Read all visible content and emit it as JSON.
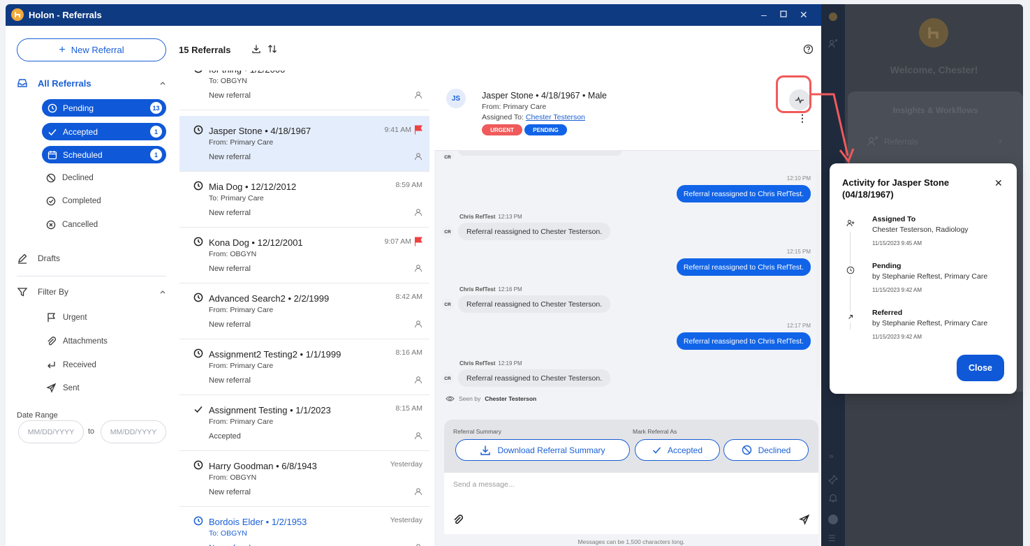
{
  "window": {
    "title": "Holon - Referrals"
  },
  "nav": {
    "new_referral": "New Referral",
    "all_referrals": "All Referrals",
    "pending": {
      "label": "Pending",
      "count": "13"
    },
    "accepted": {
      "label": "Accepted",
      "count": "1"
    },
    "scheduled": {
      "label": "Scheduled",
      "count": "1"
    },
    "declined": "Declined",
    "completed": "Completed",
    "cancelled": "Cancelled",
    "drafts": "Drafts",
    "filter_by": "Filter By",
    "urgent": "Urgent",
    "attachments": "Attachments",
    "received": "Received",
    "sent": "Sent",
    "date_range": "Date Range",
    "date_from_placeholder": "MM/DD/YYYY",
    "date_to": "to",
    "date_to_placeholder": "MM/DD/YYYY"
  },
  "list": {
    "count_label": "15 Referrals",
    "items": [
      {
        "name": "for thing • 1/2/2000",
        "from": "To: OBGYN",
        "status": "New referral",
        "time": ""
      },
      {
        "name": "Jasper Stone • 4/18/1967",
        "from": "From: Primary Care",
        "status": "New referral",
        "time": "9:41 AM"
      },
      {
        "name": "Mia Dog • 12/12/2012",
        "from": "To: Primary Care",
        "status": "New referral",
        "time": "8:59 AM"
      },
      {
        "name": "Kona Dog • 12/12/2001",
        "from": "From: OBGYN",
        "status": "New referral",
        "time": "9:07 AM"
      },
      {
        "name": "Advanced Search2 • 2/2/1999",
        "from": "From: Primary Care",
        "status": "New referral",
        "time": "8:42 AM"
      },
      {
        "name": "Assignment2 Testing2 • 1/1/1999",
        "from": "From: Primary Care",
        "status": "New referral",
        "time": "8:16 AM"
      },
      {
        "name": "Assignment Testing • 1/1/2023",
        "from": "From: Primary Care",
        "status": "Accepted",
        "time": "8:15 AM"
      },
      {
        "name": "Harry Goodman • 6/8/1943",
        "from": "From: OBGYN",
        "status": "New referral",
        "time": "Yesterday"
      },
      {
        "name": "Bordois Elder • 1/2/1953",
        "from": "To: OBGYN",
        "status": "New referral",
        "time": "Yesterday"
      }
    ]
  },
  "detail": {
    "initials": "JS",
    "patient": "Jasper Stone • 4/18/1967 • Male",
    "from": "From: Primary Care",
    "assigned_prefix": "Assigned To:",
    "assigned_to": "Chester Testerson",
    "tags": [
      "URGENT",
      "PENDING"
    ],
    "messages": [
      {
        "side": "right",
        "time": "12:10 PM",
        "text": "Referral reassigned to Chris RefTest."
      },
      {
        "side": "left",
        "author": "Chris RefTest",
        "time": "12:13 PM",
        "initials": "CR",
        "text": "Referral reassigned to Chester Testerson."
      },
      {
        "side": "right",
        "time": "12:15 PM",
        "text": "Referral reassigned to Chris RefTest."
      },
      {
        "side": "left",
        "author": "Chris RefTest",
        "time": "12:16 PM",
        "initials": "CR",
        "text": "Referral reassigned to Chester Testerson."
      },
      {
        "side": "right",
        "time": "12:17 PM",
        "text": "Referral reassigned to Chris RefTest."
      },
      {
        "side": "left",
        "author": "Chris RefTest",
        "time": "12:19 PM",
        "initials": "CR",
        "text": "Referral reassigned to Chester Testerson."
      }
    ],
    "top_initials": "CR",
    "seen_by_prefix": "Seen by",
    "seen_by": "Chester Testerson",
    "summary_label": "Referral Summary",
    "mark_label": "Mark Referral As",
    "download_btn": "Download Referral Summary",
    "accepted_btn": "Accepted",
    "declined_btn": "Declined",
    "message_placeholder": "Send a message...",
    "char_limit": "Messages can be 1,500 characters long."
  },
  "right_panel": {
    "welcome": "Welcome, Chester!",
    "insights": "Insights & Workflows",
    "referrals": "Referrals"
  },
  "activity": {
    "title": "Activity for Jasper Stone (04/18/1967)",
    "entries": [
      {
        "heading": "Assigned To",
        "by": "Chester Testerson, Radiology",
        "date": "11/15/2023 9:45 AM"
      },
      {
        "heading": "Pending",
        "by": "by Stephanie Reftest, Primary Care",
        "date": "11/15/2023 9:42 AM"
      },
      {
        "heading": "Referred",
        "by": "by Stephanie Reftest, Primary Care",
        "date": "11/15/2023 9:42 AM"
      }
    ],
    "close": "Close"
  },
  "colors": {
    "primary": "#0f58d8",
    "titlebar": "#0e3a82",
    "urgent": "#f05a5a",
    "flag": "#f04040",
    "highlight": "#f05a5a"
  }
}
